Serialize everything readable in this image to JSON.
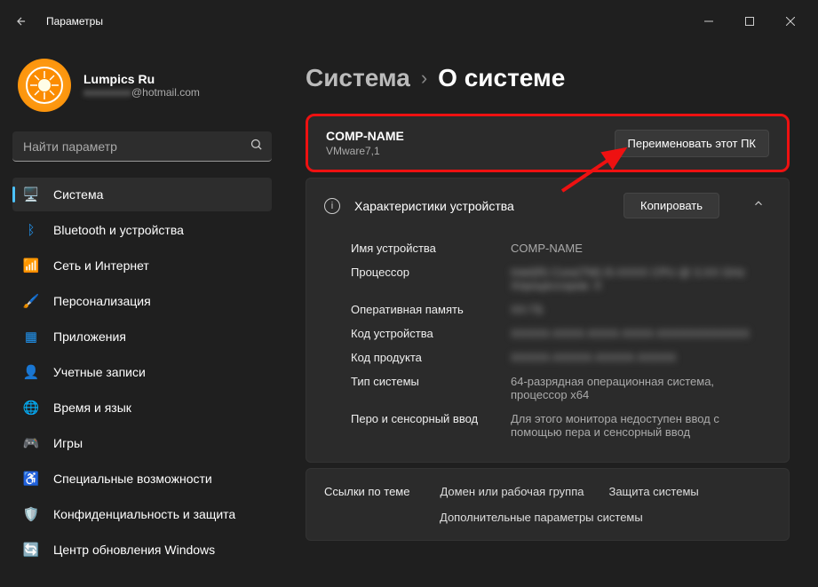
{
  "window": {
    "title": "Параметры"
  },
  "profile": {
    "name": "Lumpics Ru",
    "email_suffix": "@hotmail.com"
  },
  "search": {
    "placeholder": "Найти параметр"
  },
  "sidebar": {
    "items": [
      {
        "label": "Система",
        "icon": "🖥️",
        "color": "#4cc2ff"
      },
      {
        "label": "Bluetooth и устройства",
        "icon": "ᛒ",
        "color": "#2196f3"
      },
      {
        "label": "Сеть и Интернет",
        "icon": "📶",
        "color": "#00bcd4"
      },
      {
        "label": "Персонализация",
        "icon": "🖌️",
        "color": "#ff9800"
      },
      {
        "label": "Приложения",
        "icon": "▦",
        "color": "#2196f3"
      },
      {
        "label": "Учетные записи",
        "icon": "👤",
        "color": "#ff7043"
      },
      {
        "label": "Время и язык",
        "icon": "🌐",
        "color": "#29b6f6"
      },
      {
        "label": "Игры",
        "icon": "🎮",
        "color": "#9e9e9e"
      },
      {
        "label": "Специальные возможности",
        "icon": "♿",
        "color": "#2196f3"
      },
      {
        "label": "Конфиденциальность и защита",
        "icon": "🛡️",
        "color": "#03a9f4"
      },
      {
        "label": "Центр обновления Windows",
        "icon": "🔄",
        "color": "#00bcd4"
      }
    ]
  },
  "breadcrumb": {
    "parent": "Система",
    "current": "О системе"
  },
  "rename": {
    "computer_name": "COMP-NAME",
    "model": "VMware7,1",
    "button": "Переименовать этот ПК"
  },
  "specs": {
    "header": "Характеристики устройства",
    "copy": "Копировать",
    "rows": [
      {
        "k": "Имя устройства",
        "v": "COMP-NAME",
        "blur": false
      },
      {
        "k": "Процессор",
        "v": "Intel(R) Core(TM) i5-XXXX CPU @ 3.XX GHz Xпроцессоров: X",
        "blur": true
      },
      {
        "k": "Оперативная память",
        "v": "XX ГБ",
        "blur": true
      },
      {
        "k": "Код устройства",
        "v": "XXXXX-XXXX-XXXX-XXXX-XXXXXXXXXXXX",
        "blur": true
      },
      {
        "k": "Код продукта",
        "v": "XXXXX-XXXXX-XXXXX-XXXXX",
        "blur": true
      },
      {
        "k": "Тип системы",
        "v": "64-разрядная операционная система, процессор x64",
        "blur": false
      },
      {
        "k": "Перо и сенсорный ввод",
        "v": "Для этого монитора недоступен ввод с помощью пера и сенсорный ввод",
        "blur": false
      }
    ]
  },
  "links": {
    "title": "Ссылки по теме",
    "items": [
      "Домен или рабочая группа",
      "Защита системы",
      "Дополнительные параметры системы"
    ]
  }
}
